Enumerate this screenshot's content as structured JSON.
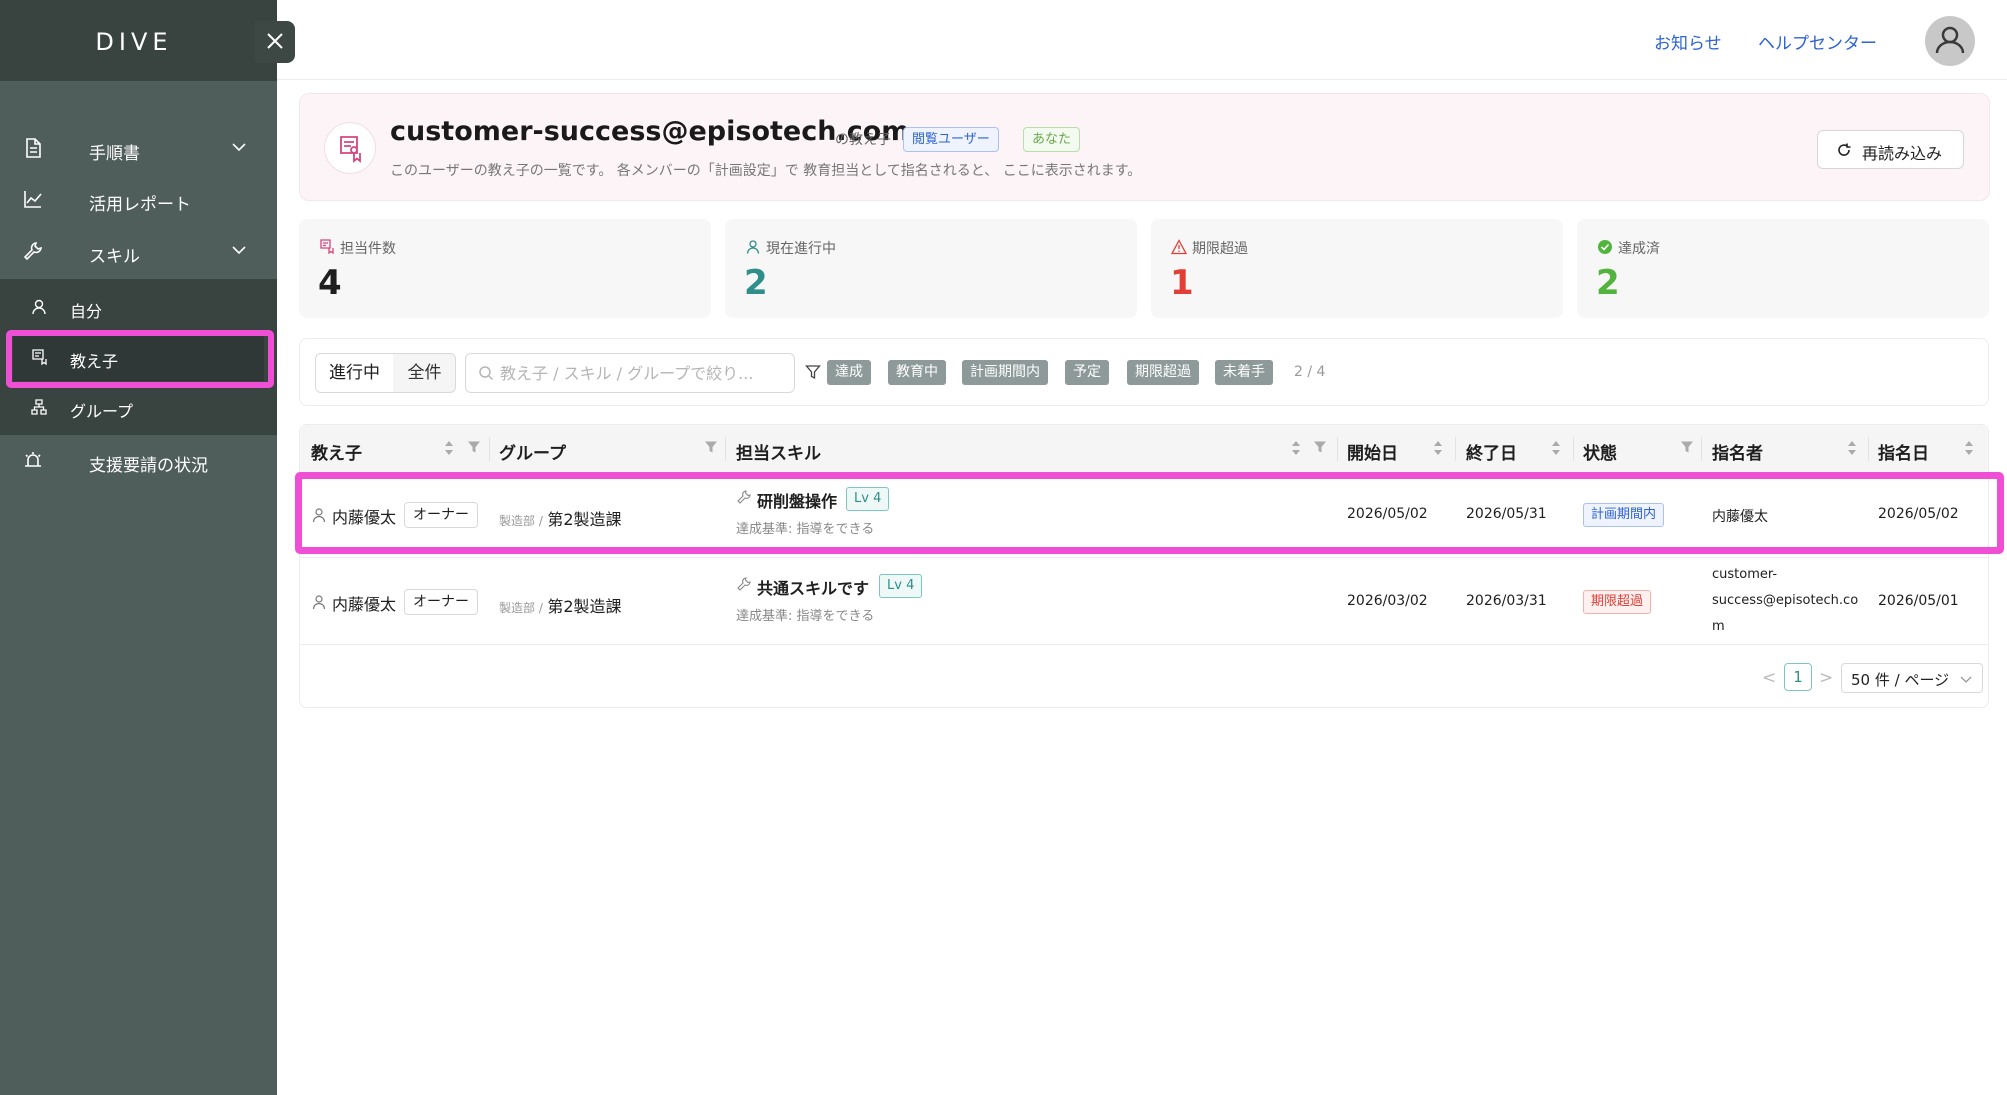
{
  "sidebar": {
    "brand": "DIVE",
    "items": [
      {
        "label": "手順書"
      },
      {
        "label": "活用レポート"
      },
      {
        "label": "スキル"
      },
      {
        "label": "支援要請の状況"
      }
    ],
    "sub_items": [
      {
        "label": "自分"
      },
      {
        "label": "教え子"
      },
      {
        "label": "グループ"
      }
    ]
  },
  "header": {
    "notice": "お知らせ",
    "help": "ヘルプセンター"
  },
  "banner": {
    "title": "customer-success@episotech.com",
    "suffix": "の教え子",
    "tag_viewer": "閲覧ユーザー",
    "tag_you": "あなた",
    "description": "このユーザーの教え子の一覧です。 各メンバーの「計画設定」で 教育担当として指名されると、 ここに表示されます。",
    "reload": "再読み込み"
  },
  "stats": [
    {
      "label": "担当件数",
      "value": "4",
      "color": "#1f1f1f"
    },
    {
      "label": "現在進行中",
      "value": "2",
      "color": "#2f8f8a"
    },
    {
      "label": "期限超過",
      "value": "1",
      "color": "#e03e36"
    },
    {
      "label": "達成済",
      "value": "2",
      "color": "#52b43d"
    }
  ],
  "filters": {
    "seg_active": "進行中",
    "seg_all": "全件",
    "search_placeholder": "教え子 / スキル / グループで絞り...",
    "chips": [
      "達成",
      "教育中",
      "計画期間内",
      "予定",
      "期限超過",
      "未着手"
    ],
    "count": "2 / 4"
  },
  "table": {
    "columns": [
      "教え子",
      "グループ",
      "担当スキル",
      "開始日",
      "終了日",
      "状態",
      "指名者",
      "指名日"
    ],
    "rows": [
      {
        "name": "内藤優太",
        "role": "オーナー",
        "group_parent": "製造部 /",
        "group_child": "第2製造課",
        "skill": "研削盤操作",
        "level": "Lv 4",
        "criteria": "達成基準: 指導をできる",
        "start": "2026/05/02",
        "end": "2026/05/31",
        "status": "計画期間内",
        "assigner": "内藤優太",
        "assigned": "2026/05/02"
      },
      {
        "name": "内藤優太",
        "role": "オーナー",
        "group_parent": "製造部 /",
        "group_child": "第2製造課",
        "skill": "共通スキルです",
        "level": "Lv 4",
        "criteria": "達成基準: 指導をできる",
        "start": "2026/03/02",
        "end": "2026/03/31",
        "status": "期限超過",
        "assigner_l1": "customer-",
        "assigner_l2": "success@episotech.co",
        "assigner_l3": "m",
        "assigned": "2026/05/01"
      }
    ]
  },
  "pagination": {
    "prev": "<",
    "page": "1",
    "next": ">",
    "page_size": "50 件 / ページ"
  }
}
